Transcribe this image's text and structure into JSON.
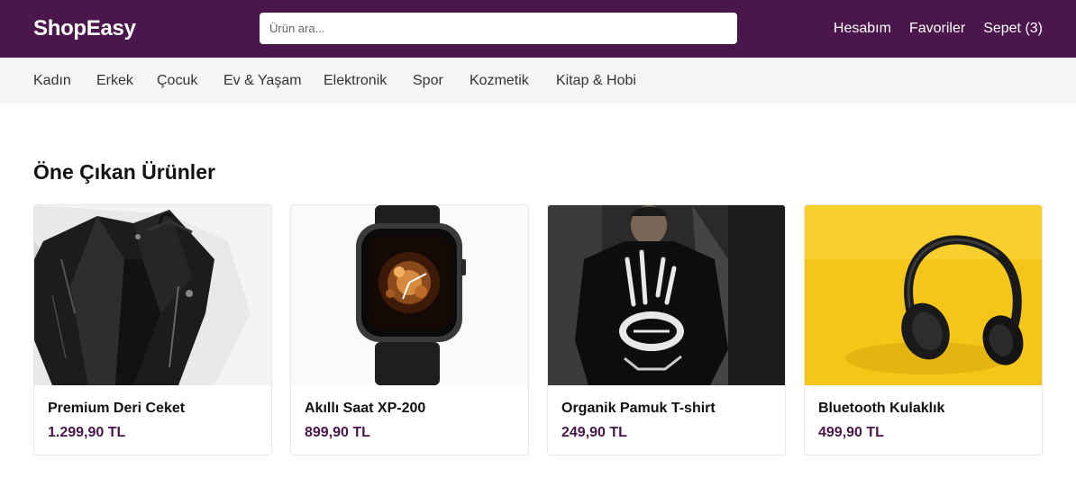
{
  "header": {
    "logo": "ShopEasy",
    "search_placeholder": "Ürün ara...",
    "links": [
      "Hesabım",
      "Favoriler",
      "Sepet (3)"
    ]
  },
  "categories": [
    "Kadın",
    "Erkek",
    "Çocuk",
    "Ev & Yaşam",
    "Elektronik",
    "Spor",
    "Kozmetik",
    "Kitap & Hobi"
  ],
  "section": {
    "title": "Öne Çıkan Ürünler"
  },
  "products": [
    {
      "name": "Premium Deri Ceket",
      "price": "1.299,90 TL",
      "image": "leather-jacket"
    },
    {
      "name": "Akıllı Saat XP-200",
      "price": "899,90 TL",
      "image": "smart-watch"
    },
    {
      "name": "Organik Pamuk T-shirt",
      "price": "249,90 TL",
      "image": "black-tshirt"
    },
    {
      "name": "Bluetooth Kulaklık",
      "price": "499,90 TL",
      "image": "headphones"
    }
  ],
  "colors": {
    "brand": "#4a164b",
    "category_bar": "#f7f6f6",
    "price": "#4a164b"
  }
}
